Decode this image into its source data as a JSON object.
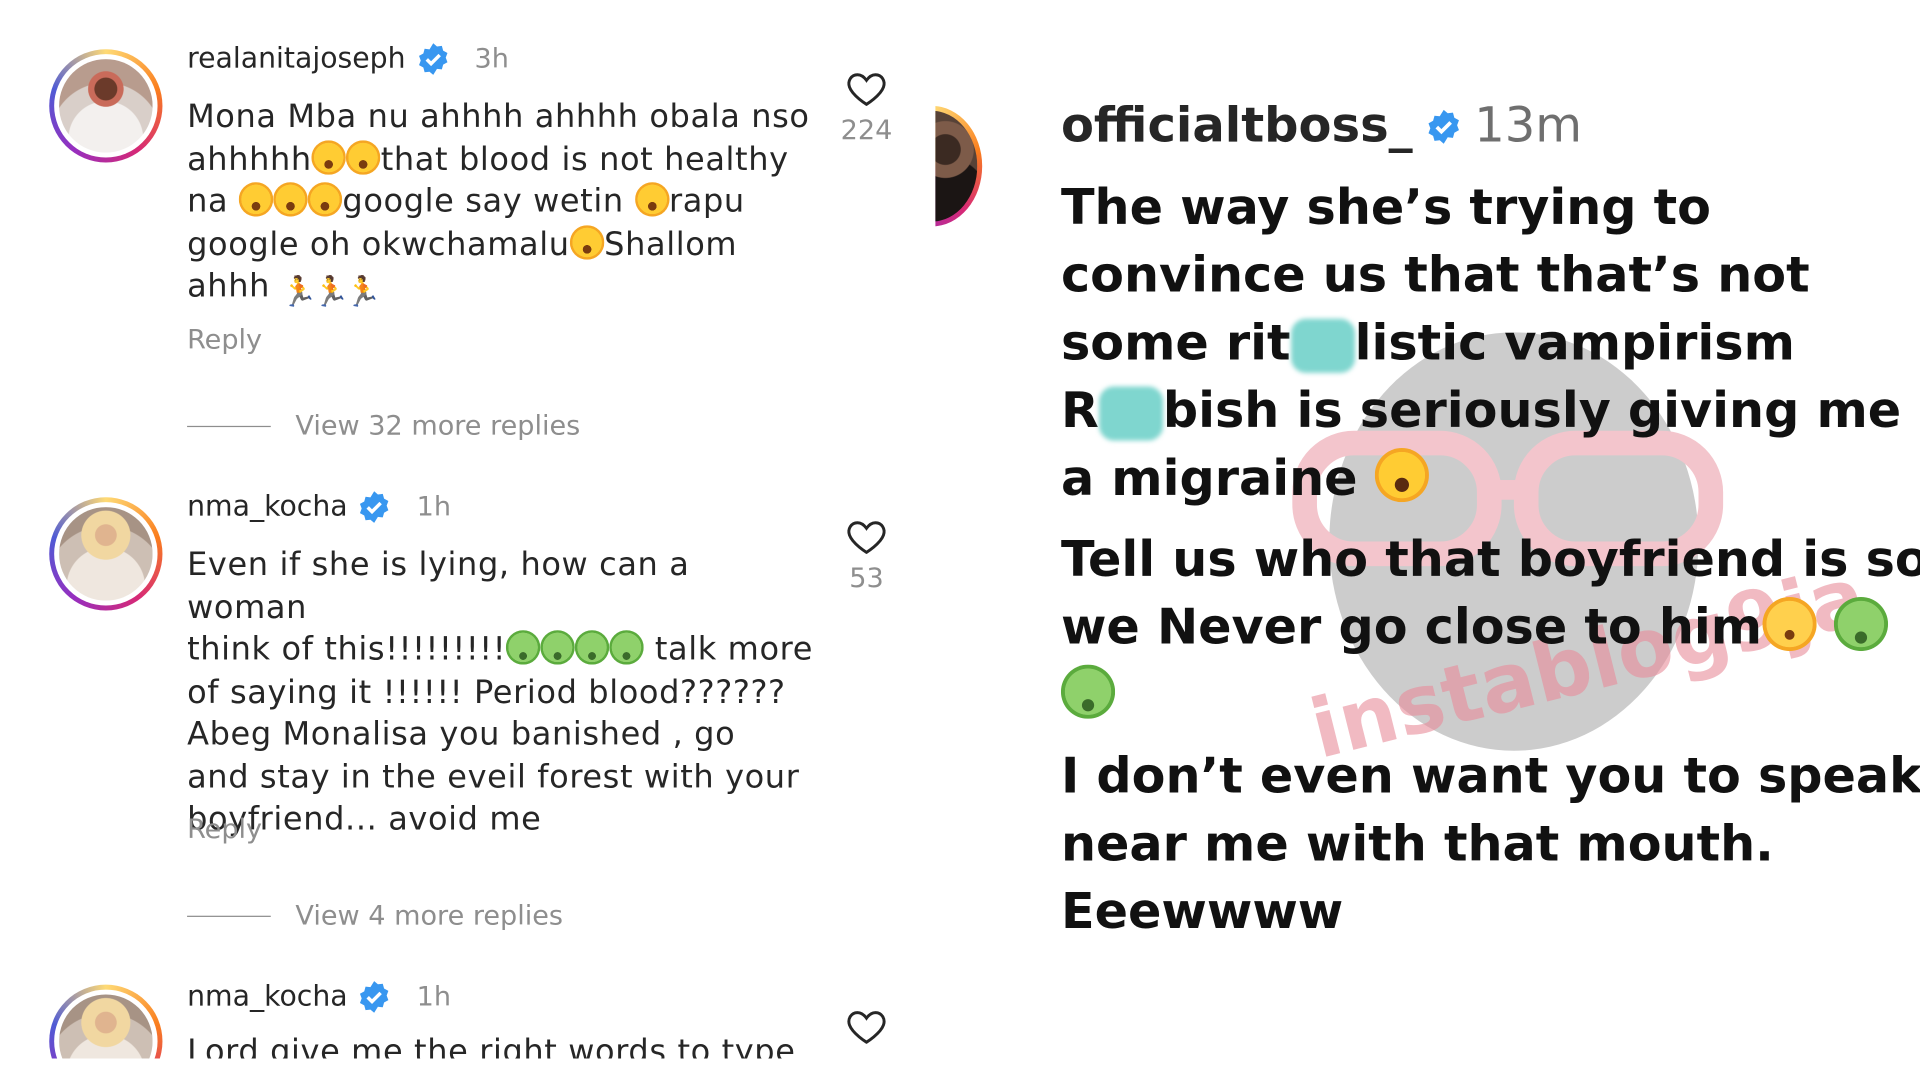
{
  "left_panel": {
    "comments": [
      {
        "username": "realanitajoseph",
        "time": "3h",
        "lines": [
          "Mona Mba nu ahhhh ahhhh obala nso",
          "ahhhhh",
          "that blood is not healthy",
          "na ",
          "google say wetin ",
          "rapu",
          "google oh okwchamalu",
          "Shallom",
          "ahhh "
        ],
        "reply_label": "Reply",
        "like_count": "224",
        "more_replies": "View 32 more replies"
      },
      {
        "username": "nma_kocha",
        "time": "1h",
        "lines": [
          "Even if she is lying, how can a woman",
          "think of this!!!!!!!!!",
          " talk more",
          "of saying it !!!!!! Period blood??????",
          "Abeg Monalisa you banished , go",
          "and stay in the eveil forest with your",
          "boyfriend... avoid me"
        ],
        "reply_label": "Reply",
        "like_count": "53",
        "more_replies": "View 4 more replies"
      },
      {
        "username": "nma_kocha",
        "time": "1h",
        "lines": [
          "Lord give me the right words to type"
        ]
      }
    ]
  },
  "right_panel": {
    "username": "officialtboss_",
    "time": "13m",
    "lines": [
      "The way she’s trying to",
      "convince us that that’s not",
      "some rit",
      "listic vampirism",
      "R",
      "bish is seriously giving me",
      "a migraine ",
      " Tell us who that boyfriend is so",
      "we Never go close to him",
      " I don’t even want you to speak",
      "near me with that mouth.",
      "Eeewwww"
    ],
    "watermark": "instablog9ja"
  },
  "colors": {
    "verified_blue": "#3897f0",
    "secondary_text": "#8e8e8e",
    "primary_text": "#262626"
  },
  "icons": [
    "heart-icon",
    "verified-badge-icon",
    "laughing-emoji",
    "sick-emoji",
    "runner-emoji",
    "shocked-emoji",
    "woozy-emoji"
  ]
}
